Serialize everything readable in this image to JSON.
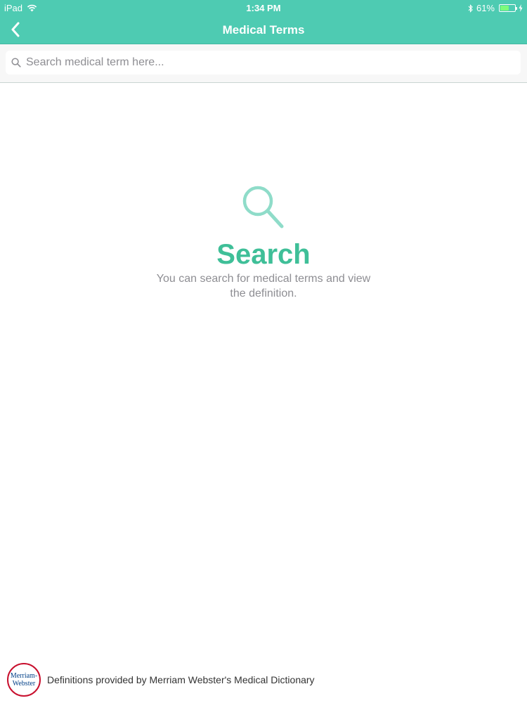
{
  "status_bar": {
    "device": "iPad",
    "time": "1:34 PM",
    "battery_percent": "61%",
    "battery_level": 0.61,
    "icons": [
      "wifi-icon",
      "bluetooth-icon",
      "battery-icon",
      "charging-icon"
    ]
  },
  "nav": {
    "title": "Medical Terms",
    "back_icon": "chevron-left-icon"
  },
  "search": {
    "placeholder": "Search medical term here...",
    "value": "",
    "icon": "search-icon"
  },
  "empty_state": {
    "icon": "search-icon",
    "title": "Search",
    "description": "You can search for medical terms and view the definition."
  },
  "footer": {
    "logo_line1": "Merriam-",
    "logo_line2": "Webster",
    "text": "Definitions provided by Merriam Webster's Medical Dictionary"
  },
  "colors": {
    "accent": "#4ecbb2",
    "title": "#3fbf98",
    "icon": "#8fdcc9"
  }
}
